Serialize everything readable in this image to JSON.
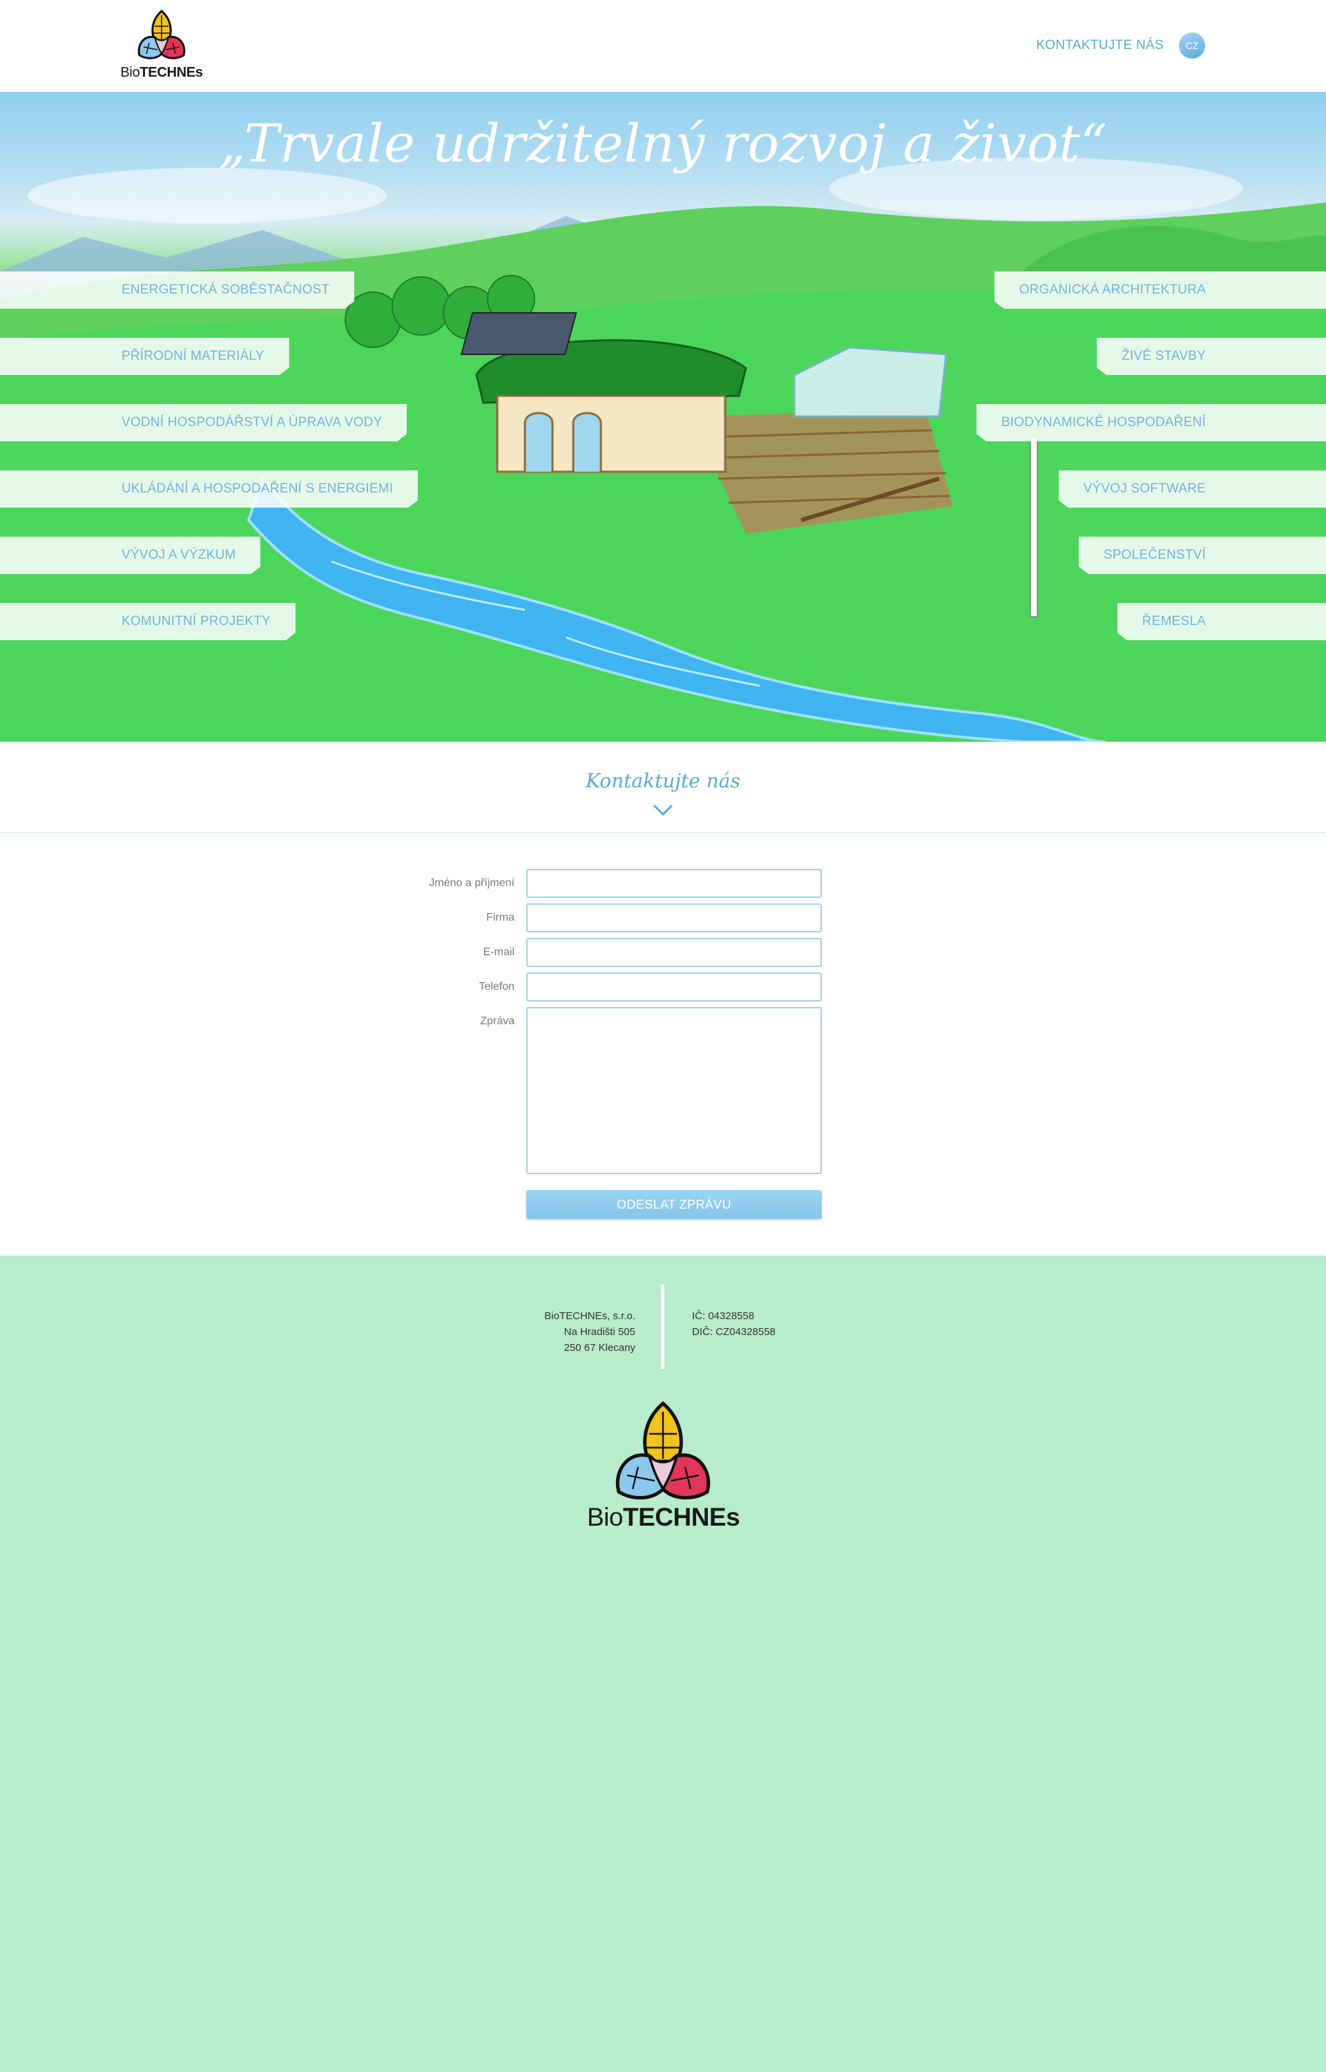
{
  "header": {
    "logo": {
      "prefix": "Bio",
      "brand": "TECHNEs"
    },
    "contact_link": "KONTAKTUJTE NÁS",
    "language": "CZ"
  },
  "hero": {
    "title": "„Trvale udržitelný rozvoj a život“",
    "left_tags": [
      "ENERGETICKÁ SOBĚSTAČNOST",
      "PŘÍRODNÍ MATERIÁLY",
      "VODNÍ HOSPODÁŘSTVÍ A ÚPRAVA VODY",
      "UKLÁDÁNÍ A HOSPODAŘENÍ S ENERGIEMI",
      "VÝVOJ A VÝZKUM",
      "KOMUNITNÍ PROJEKTY"
    ],
    "right_tags": [
      "ORGANICKÁ ARCHITEKTURA",
      "ŽIVÉ STAVBY",
      "BIODYNAMICKÉ HOSPODAŘENÍ",
      "VÝVOJ SOFTWARE",
      "SPOLEČENSTVÍ",
      "ŘEMESLA"
    ]
  },
  "contact": {
    "heading": "Kontaktujte nás",
    "fields": {
      "name": {
        "label": "Jméno a příjmení",
        "value": ""
      },
      "company": {
        "label": "Firma",
        "value": ""
      },
      "email": {
        "label": "E-mail",
        "value": ""
      },
      "phone": {
        "label": "Telefon",
        "value": ""
      },
      "message": {
        "label": "Zpráva",
        "value": ""
      }
    },
    "submit": "ODESLAT ZPRÁVU"
  },
  "footer": {
    "address": [
      "BioTECHNEs, s.r.o.",
      "Na Hradišti 505",
      "250 67  Klecany"
    ],
    "ids": [
      "IČ: 04328558",
      "DIČ: CZ04328558"
    ],
    "logo": {
      "prefix": "Bio",
      "brand": "TECHNEs"
    }
  },
  "colors": {
    "accent": "#5aa9dc",
    "footer_bg": "#b9ebcd",
    "logo_yellow": "#f3c21b",
    "logo_blue": "#8cc8ec",
    "logo_red": "#e2375a"
  },
  "icons": [
    "logo-icon",
    "chevron-down-icon"
  ]
}
